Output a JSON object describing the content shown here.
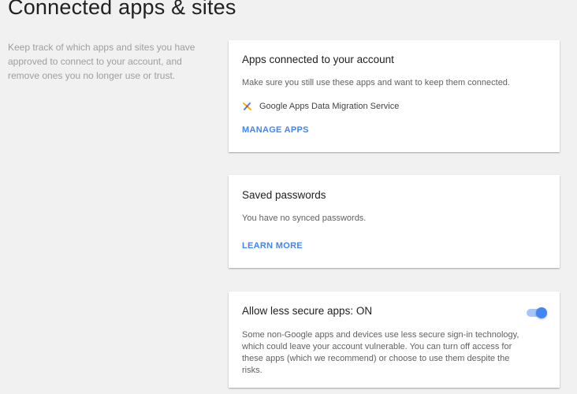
{
  "page": {
    "title": "Connected apps & sites",
    "description": "Keep track of which apps and sites you have approved to connect to your account, and remove ones you no longer use or trust."
  },
  "connected_apps": {
    "title": "Apps connected to your account",
    "text": "Make sure you still use these apps and want to keep them connected.",
    "apps": [
      {
        "name": "Google Apps Data Migration Service",
        "icon": "data-migration-icon"
      }
    ],
    "action_label": "MANAGE APPS"
  },
  "saved_passwords": {
    "title": "Saved passwords",
    "text": "You have no synced passwords.",
    "action_label": "LEARN MORE"
  },
  "less_secure": {
    "title": "Allow less secure apps: ON",
    "text": "Some non-Google apps and devices use less secure sign-in technology, which could leave your account vulnerable. You can turn off access for these apps (which we recommend) or choose to use them despite the risks.",
    "toggle_on": true
  },
  "colors": {
    "link": "#4285f4",
    "toggle_track": "#a6c6f7",
    "toggle_thumb": "#4285f4",
    "background": "#f1f1f1"
  }
}
